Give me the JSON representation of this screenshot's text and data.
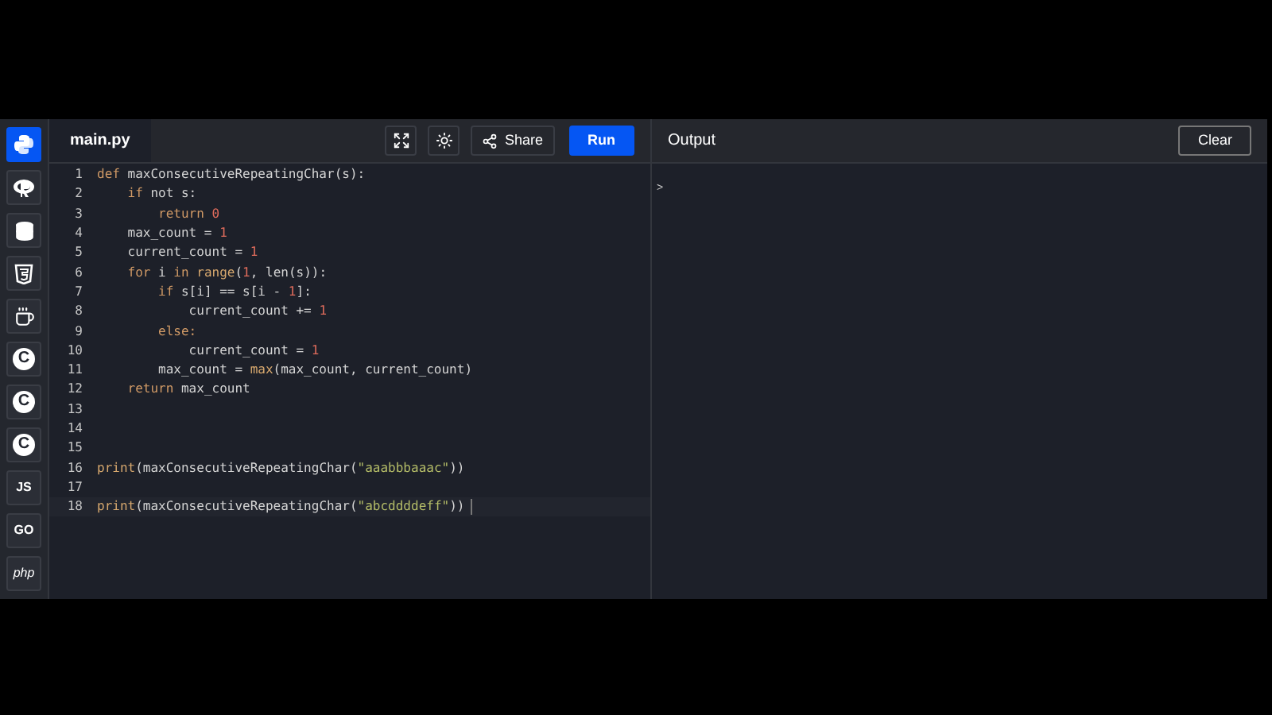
{
  "sidebar": {
    "items": [
      {
        "kind": "python",
        "selected": true
      },
      {
        "kind": "r",
        "selected": false
      },
      {
        "kind": "database",
        "selected": false
      },
      {
        "kind": "html5",
        "selected": false
      },
      {
        "kind": "java",
        "selected": false
      },
      {
        "kind": "hex",
        "label": "C",
        "selected": false
      },
      {
        "kind": "hex",
        "label": "C",
        "selected": false
      },
      {
        "kind": "hex",
        "label": "C",
        "selected": false
      },
      {
        "kind": "text",
        "label": "JS",
        "selected": false
      },
      {
        "kind": "text",
        "label": "GO",
        "selected": false
      },
      {
        "kind": "italic",
        "label": "php",
        "selected": false
      }
    ]
  },
  "editor": {
    "tab": "main.py",
    "share": "Share",
    "run": "Run",
    "lines": [
      {
        "number": "1",
        "tokens": [
          {
            "kind": "keyword",
            "text": "def"
          },
          {
            "kind": "name",
            "text": " maxConsecutiveRepeatingChar(s):"
          }
        ]
      },
      {
        "number": "2",
        "tokens": [
          {
            "kind": "keyword",
            "text": "    if"
          },
          {
            "kind": "name",
            "text": " not s:"
          }
        ]
      },
      {
        "number": "3",
        "tokens": [
          {
            "kind": "keyword",
            "text": "        return "
          },
          {
            "kind": "number",
            "text": "0"
          }
        ]
      },
      {
        "number": "4",
        "tokens": [
          {
            "kind": "name",
            "text": "    max_count = "
          },
          {
            "kind": "number",
            "text": "1"
          }
        ]
      },
      {
        "number": "5",
        "tokens": [
          {
            "kind": "name",
            "text": "    current_count = "
          },
          {
            "kind": "number",
            "text": "1"
          }
        ]
      },
      {
        "number": "6",
        "tokens": [
          {
            "kind": "keyword",
            "text": "    for"
          },
          {
            "kind": "name",
            "text": " i "
          },
          {
            "kind": "keyword",
            "text": "in"
          },
          {
            "kind": "func",
            "text": " range"
          },
          {
            "kind": "name",
            "text": "("
          },
          {
            "kind": "number",
            "text": "1"
          },
          {
            "kind": "name",
            "text": ", len(s)):"
          }
        ]
      },
      {
        "number": "7",
        "tokens": [
          {
            "kind": "keyword",
            "text": "        if"
          },
          {
            "kind": "name",
            "text": " s[i] == s[i - "
          },
          {
            "kind": "number",
            "text": "1"
          },
          {
            "kind": "name",
            "text": "]:"
          }
        ]
      },
      {
        "number": "8",
        "tokens": [
          {
            "kind": "name",
            "text": "            current_count += "
          },
          {
            "kind": "number",
            "text": "1"
          }
        ]
      },
      {
        "number": "9",
        "tokens": [
          {
            "kind": "keyword",
            "text": "        else:"
          }
        ]
      },
      {
        "number": "10",
        "tokens": [
          {
            "kind": "name",
            "text": "            current_count = "
          },
          {
            "kind": "number",
            "text": "1"
          }
        ]
      },
      {
        "number": "11",
        "tokens": [
          {
            "kind": "name",
            "text": "        max_count = "
          },
          {
            "kind": "func",
            "text": "max"
          },
          {
            "kind": "name",
            "text": "(max_count, current_count)"
          }
        ]
      },
      {
        "number": "12",
        "tokens": [
          {
            "kind": "keyword",
            "text": "    return"
          },
          {
            "kind": "name",
            "text": " max_count"
          }
        ]
      },
      {
        "number": "13"
      },
      {
        "number": "14"
      },
      {
        "number": "15"
      },
      {
        "number": "16",
        "tokens": [
          {
            "kind": "func",
            "text": "print"
          },
          {
            "kind": "name",
            "text": "(maxConsecutiveRepeatingChar("
          },
          {
            "kind": "string",
            "text": "\"aaabbbaaac\""
          },
          {
            "kind": "name",
            "text": "))"
          }
        ]
      },
      {
        "number": "17"
      },
      {
        "number": "18",
        "selected": true,
        "tokens": [
          {
            "kind": "func",
            "text": "print"
          },
          {
            "kind": "name",
            "text": "(maxConsecutiveRepeatingChar("
          },
          {
            "kind": "string",
            "text": "\"abcddddeff\""
          },
          {
            "kind": "name",
            "text": "))"
          }
        ]
      }
    ]
  },
  "output": {
    "title": "Output",
    "clear": "Clear",
    "prompt": ">"
  }
}
